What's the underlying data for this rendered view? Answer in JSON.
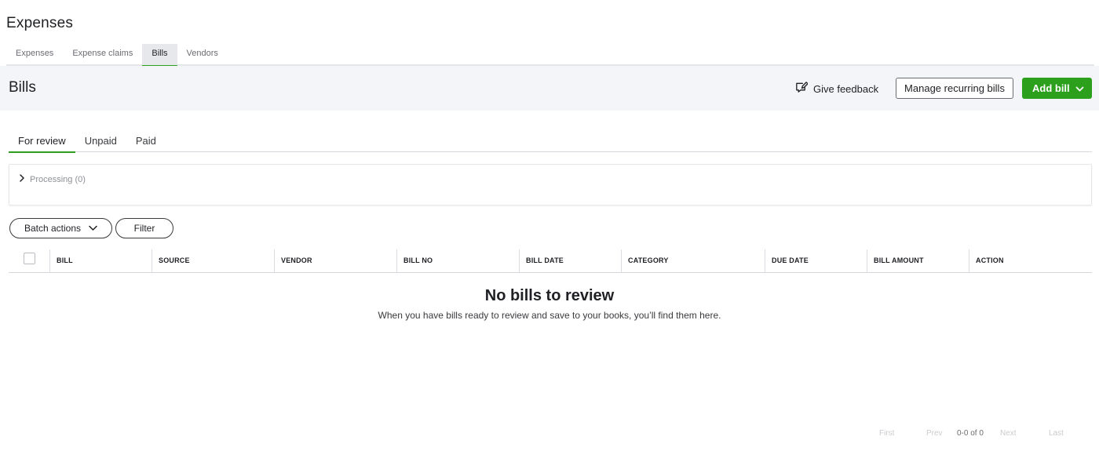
{
  "page": {
    "title": "Expenses"
  },
  "top_tabs": [
    {
      "label": "Expenses"
    },
    {
      "label": "Expense claims"
    },
    {
      "label": "Bills",
      "active": true
    },
    {
      "label": "Vendors"
    }
  ],
  "bills_header": {
    "title": "Bills",
    "feedback_label": "Give feedback",
    "manage_label": "Manage recurring bills",
    "add_label": "Add bill"
  },
  "sub_tabs": [
    {
      "label": "For review",
      "active": true
    },
    {
      "label": "Unpaid"
    },
    {
      "label": "Paid"
    }
  ],
  "processing": {
    "label": "Processing (0)"
  },
  "toolbar": {
    "batch_label": "Batch actions",
    "filter_label": "Filter"
  },
  "table": {
    "columns": [
      "BILL",
      "SOURCE",
      "VENDOR",
      "BILL NO",
      "BILL DATE",
      "CATEGORY",
      "DUE DATE",
      "BILL AMOUNT",
      "ACTION"
    ]
  },
  "empty_state": {
    "title": "No bills to review",
    "subtitle": "When you have bills ready to review and save to your books, you’ll find them here."
  },
  "pagination": {
    "first": "First",
    "prev": "Prev",
    "range": "0-0 of 0",
    "next": "Next",
    "last": "Last"
  },
  "colors": {
    "accent": "#2ca01c",
    "header_bg": "#f4f5f8",
    "text": "#393a3d"
  },
  "icons": {
    "feedback": "feedback-icon",
    "processing": "chevron-right-icon",
    "dropdown": "chevron-down-icon"
  }
}
